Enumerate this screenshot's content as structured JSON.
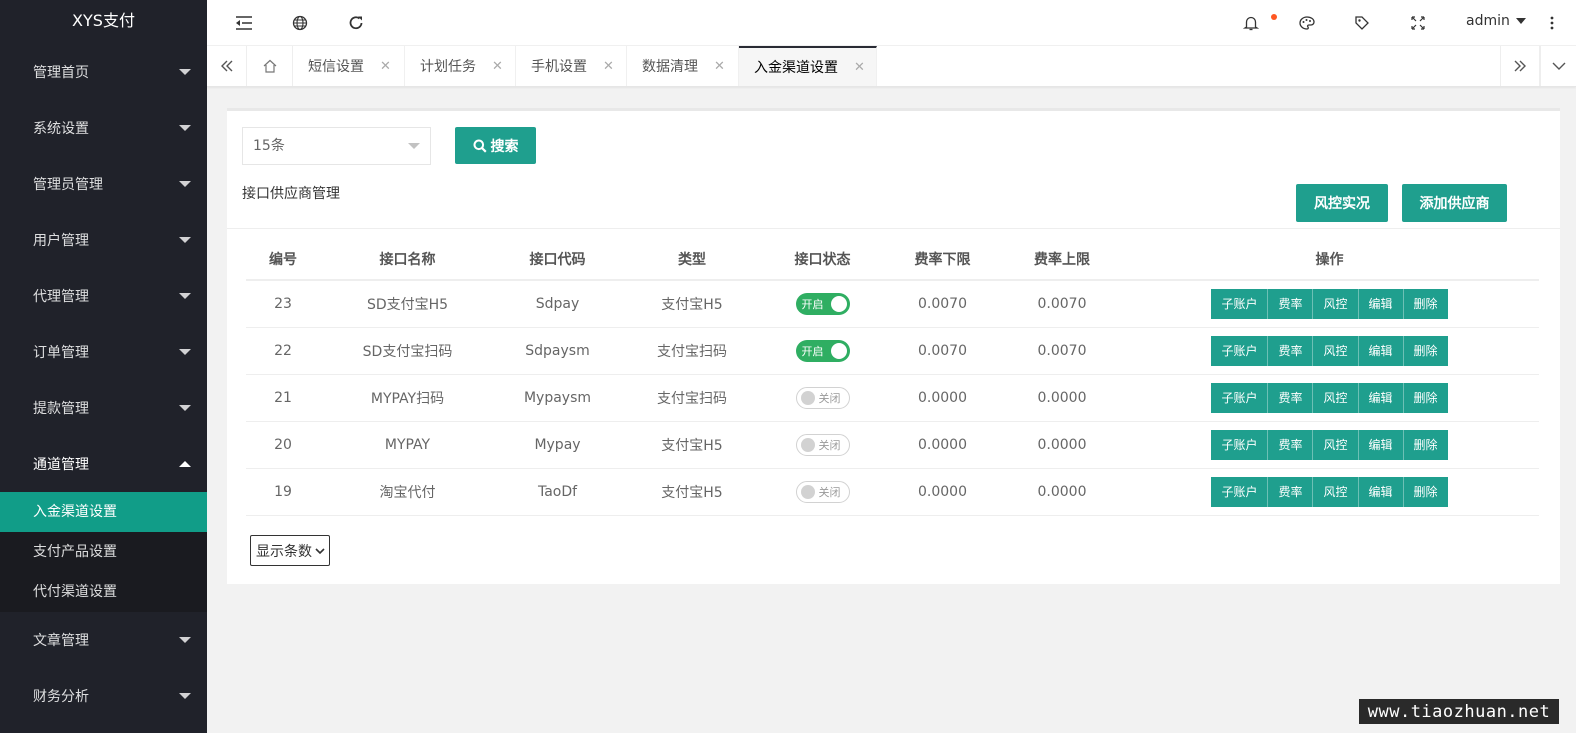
{
  "app": {
    "logo": "XYS支付"
  },
  "sidebar": {
    "items": [
      {
        "label": "管理首页"
      },
      {
        "label": "系统设置"
      },
      {
        "label": "管理员管理"
      },
      {
        "label": "用户管理"
      },
      {
        "label": "代理管理"
      },
      {
        "label": "订单管理"
      },
      {
        "label": "提款管理"
      },
      {
        "label": "通道管理"
      }
    ],
    "submenu": [
      {
        "label": "入金渠道设置",
        "active": true
      },
      {
        "label": "支付产品设置"
      },
      {
        "label": "代付渠道设置"
      }
    ],
    "items_after": [
      {
        "label": "文章管理"
      },
      {
        "label": "财务分析"
      }
    ]
  },
  "header": {
    "user": "admin",
    "icons": [
      "menu-fold-icon",
      "globe-icon",
      "refresh-icon",
      "bell-icon",
      "palette-icon",
      "tag-icon",
      "fullscreen-icon",
      "more-icon"
    ]
  },
  "tabs": [
    {
      "label": "短信设置"
    },
    {
      "label": "计划任务"
    },
    {
      "label": "手机设置"
    },
    {
      "label": "数据清理"
    },
    {
      "label": "入金渠道设置",
      "active": true
    }
  ],
  "toolbar": {
    "page_size": "15条",
    "search_label": "搜索",
    "section_title": "接口供应商管理",
    "risk_label": "风控实况",
    "add_label": "添加供应商"
  },
  "table": {
    "headers": [
      "编号",
      "接口名称",
      "接口代码",
      "类型",
      "接口状态",
      "费率下限",
      "费率上限",
      "操作"
    ],
    "rows": [
      {
        "id": "23",
        "name": "SD支付宝H5",
        "code": "Sdpay",
        "type": "支付宝H5",
        "status": "开启",
        "on": true,
        "min": "0.0070",
        "max": "0.0070"
      },
      {
        "id": "22",
        "name": "SD支付宝扫码",
        "code": "Sdpaysm",
        "type": "支付宝扫码",
        "status": "开启",
        "on": true,
        "min": "0.0070",
        "max": "0.0070"
      },
      {
        "id": "21",
        "name": "MYPAY扫码",
        "code": "Mypaysm",
        "type": "支付宝扫码",
        "status": "关闭",
        "on": false,
        "min": "0.0000",
        "max": "0.0000"
      },
      {
        "id": "20",
        "name": "MYPAY",
        "code": "Mypay",
        "type": "支付宝H5",
        "status": "关闭",
        "on": false,
        "min": "0.0000",
        "max": "0.0000"
      },
      {
        "id": "19",
        "name": "淘宝代付",
        "code": "TaoDf",
        "type": "支付宝H5",
        "status": "关闭",
        "on": false,
        "min": "0.0000",
        "max": "0.0000"
      }
    ],
    "actions": [
      "子账户",
      "费率",
      "风控",
      "编辑",
      "删除"
    ]
  },
  "footer": {
    "per_page_label": "显示条数"
  },
  "watermark": "www.tiaozhuan.net",
  "colors": {
    "accent": "#1f9f8e",
    "sidebar": "#20222a",
    "switch_on": "#2fae62"
  }
}
